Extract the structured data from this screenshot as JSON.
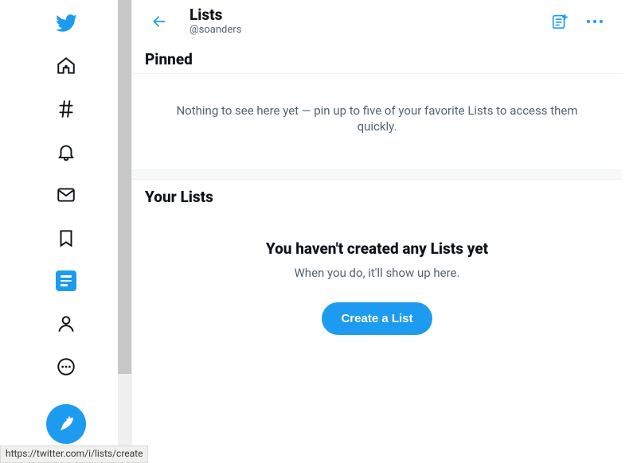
{
  "header": {
    "title": "Lists",
    "handle": "@soanders"
  },
  "pinned": {
    "heading": "Pinned",
    "empty_text": "Nothing to see here yet — pin up to five of your favorite Lists to access them quickly."
  },
  "your_lists": {
    "heading": "Your Lists",
    "empty_title": "You haven't created any Lists yet",
    "empty_sub": "When you do, it'll show up here.",
    "create_label": "Create a List"
  },
  "status_url": "https://twitter.com/i/lists/create"
}
